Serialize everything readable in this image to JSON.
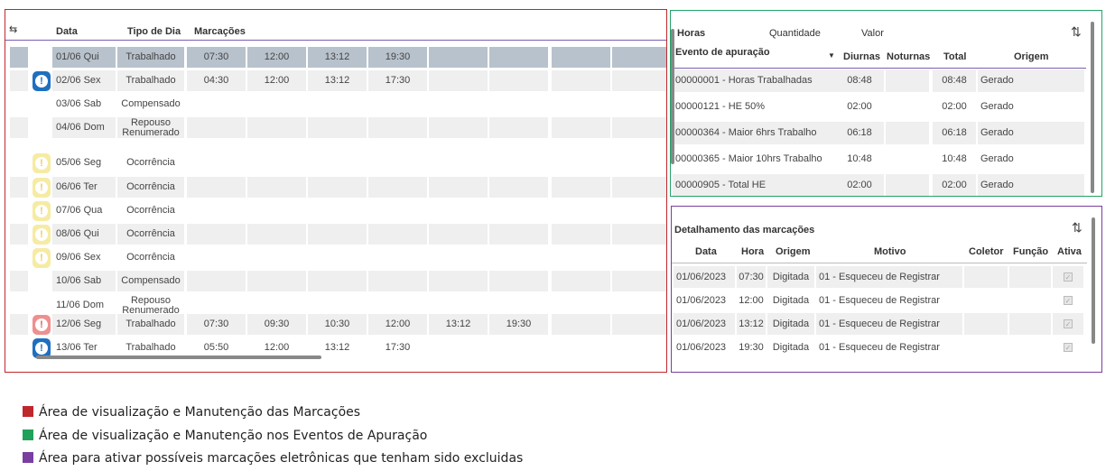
{
  "marcacoes": {
    "headers": {
      "data": "Data",
      "tipo": "Tipo de Dia",
      "marcacoes": "Marcações"
    },
    "rows": [
      {
        "data": "01/06 Qui",
        "tipo": "Trabalhado",
        "marks": [
          "07:30",
          "12:00",
          "13:12",
          "19:30"
        ],
        "alert": "",
        "selected": true
      },
      {
        "data": "02/06 Sex",
        "tipo": "Trabalhado",
        "marks": [
          "04:30",
          "12:00",
          "13:12",
          "17:30"
        ],
        "alert": "blue"
      },
      {
        "data": "03/06 Sab",
        "tipo": "Compensado",
        "marks": [],
        "alert": ""
      },
      {
        "data": "04/06 Dom",
        "tipo": "Repouso Renumerado",
        "marks": [],
        "alert": ""
      },
      {
        "data": "05/06 Seg",
        "tipo": "Ocorrência",
        "marks": [],
        "alert": "yellow"
      },
      {
        "data": "06/06 Ter",
        "tipo": "Ocorrência",
        "marks": [],
        "alert": "yellow"
      },
      {
        "data": "07/06 Qua",
        "tipo": "Ocorrência",
        "marks": [],
        "alert": "yellow"
      },
      {
        "data": "08/06 Qui",
        "tipo": "Ocorrência",
        "marks": [],
        "alert": "yellow"
      },
      {
        "data": "09/06 Sex",
        "tipo": "Ocorrência",
        "marks": [],
        "alert": "yellow"
      },
      {
        "data": "10/06 Sab",
        "tipo": "Compensado",
        "marks": [],
        "alert": ""
      },
      {
        "data": "11/06 Dom",
        "tipo": "Repouso Renumerado",
        "marks": [],
        "alert": ""
      },
      {
        "data": "12/06 Seg",
        "tipo": "Trabalhado",
        "marks": [
          "07:30",
          "09:30",
          "10:30",
          "12:00",
          "13:12",
          "19:30"
        ],
        "alert": "red"
      },
      {
        "data": "13/06 Ter",
        "tipo": "Trabalhado",
        "marks": [
          "05:50",
          "12:00",
          "13:12",
          "17:30"
        ],
        "alert": "blue"
      }
    ],
    "alert_glyph": "!"
  },
  "eventos": {
    "tabs": {
      "horas": "Horas",
      "quantidade": "Quantidade",
      "valor": "Valor"
    },
    "headers": {
      "evento": "Evento de apuração",
      "diurnas": "Diurnas",
      "noturnas": "Noturnas",
      "total": "Total",
      "origem": "Origem"
    },
    "rows": [
      {
        "evento": "00000001 - Horas Trabalhadas",
        "diurnas": "08:48",
        "noturnas": "",
        "total": "08:48",
        "origem": "Gerado"
      },
      {
        "evento": "00000121 - HE 50%",
        "diurnas": "02:00",
        "noturnas": "",
        "total": "02:00",
        "origem": "Gerado"
      },
      {
        "evento": "00000364 - Maior 6hrs Trabalho",
        "diurnas": "06:18",
        "noturnas": "",
        "total": "06:18",
        "origem": "Gerado"
      },
      {
        "evento": "00000365 - Maior 10hrs Trabalho",
        "diurnas": "10:48",
        "noturnas": "",
        "total": "10:48",
        "origem": "Gerado"
      },
      {
        "evento": "00000905 - Total HE",
        "diurnas": "02:00",
        "noturnas": "",
        "total": "02:00",
        "origem": "Gerado"
      }
    ]
  },
  "detalhamento": {
    "title": "Detalhamento das marcações",
    "headers": {
      "data": "Data",
      "hora": "Hora",
      "origem": "Origem",
      "motivo": "Motivo",
      "coletor": "Coletor",
      "funcao": "Função",
      "ativa": "Ativa"
    },
    "rows": [
      {
        "data": "01/06/2023",
        "hora": "07:30",
        "origem": "Digitada",
        "motivo": "01 - Esqueceu de Registrar",
        "coletor": "",
        "funcao": "",
        "ativa": true
      },
      {
        "data": "01/06/2023",
        "hora": "12:00",
        "origem": "Digitada",
        "motivo": "01 - Esqueceu de Registrar",
        "coletor": "",
        "funcao": "",
        "ativa": true
      },
      {
        "data": "01/06/2023",
        "hora": "13:12",
        "origem": "Digitada",
        "motivo": "01 - Esqueceu de Registrar",
        "coletor": "",
        "funcao": "",
        "ativa": true
      },
      {
        "data": "01/06/2023",
        "hora": "19:30",
        "origem": "Digitada",
        "motivo": "01 - Esqueceu de Registrar",
        "coletor": "",
        "funcao": "",
        "ativa": true
      }
    ]
  },
  "legend": [
    {
      "color": "#c0272d",
      "label": "Área de visualização e Manutenção das Marcações"
    },
    {
      "color": "#1fa15a",
      "label": "Área de visualização e Manutenção nos Eventos de Apuração"
    },
    {
      "color": "#7a3ea0",
      "label": "Área para ativar possíveis marcações eletrônicas que tenham sido excluidas"
    }
  ]
}
